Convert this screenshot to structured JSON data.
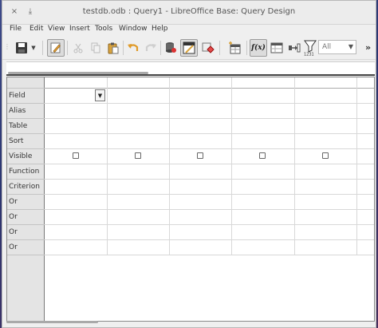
{
  "window": {
    "title": "testdb.odb : Query1 - LibreOffice Base: Query Design",
    "close_glyph": "×",
    "minimize_glyph": "⤓"
  },
  "menu": {
    "items": [
      "File",
      "Edit",
      "View",
      "Insert",
      "Tools",
      "Window",
      "Help"
    ]
  },
  "toolbar": {
    "limit_value": "All",
    "overflow_glyph": "»",
    "limit_icon_label": "1231",
    "function_icon_label": "f(x)"
  },
  "grid": {
    "row_labels": [
      "Field",
      "Alias",
      "Table",
      "Sort",
      "Visible",
      "Function",
      "Criterion",
      "Or",
      "Or",
      "Or",
      "Or"
    ],
    "column_count": 5,
    "visible_checked": [
      false,
      false,
      false,
      false,
      false
    ]
  }
}
